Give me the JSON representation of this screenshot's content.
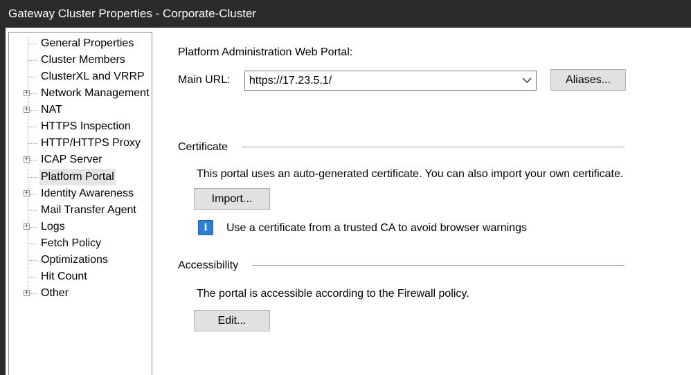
{
  "window": {
    "title": "Gateway Cluster Properties - Corporate-Cluster"
  },
  "tree": {
    "items": [
      {
        "label": "General Properties",
        "expandable": false,
        "selected": false
      },
      {
        "label": "Cluster Members",
        "expandable": false,
        "selected": false
      },
      {
        "label": "ClusterXL and VRRP",
        "expandable": false,
        "selected": false
      },
      {
        "label": "Network Management",
        "expandable": true,
        "selected": false
      },
      {
        "label": "NAT",
        "expandable": true,
        "selected": false
      },
      {
        "label": "HTTPS Inspection",
        "expandable": false,
        "selected": false
      },
      {
        "label": "HTTP/HTTPS Proxy",
        "expandable": false,
        "selected": false
      },
      {
        "label": "ICAP Server",
        "expandable": true,
        "selected": false
      },
      {
        "label": "Platform Portal",
        "expandable": false,
        "selected": true
      },
      {
        "label": "Identity Awareness",
        "expandable": true,
        "selected": false
      },
      {
        "label": "Mail Transfer Agent",
        "expandable": false,
        "selected": false
      },
      {
        "label": "Logs",
        "expandable": true,
        "selected": false
      },
      {
        "label": "Fetch Policy",
        "expandable": false,
        "selected": false
      },
      {
        "label": "Optimizations",
        "expandable": false,
        "selected": false
      },
      {
        "label": "Hit Count",
        "expandable": false,
        "selected": false
      },
      {
        "label": "Other",
        "expandable": true,
        "selected": false
      }
    ]
  },
  "portal": {
    "heading": "Platform Administration Web Portal:",
    "main_url_label": "Main URL:",
    "main_url_value": "https://17.23.5.1/",
    "aliases_button": "Aliases..."
  },
  "certificate": {
    "group_label": "Certificate",
    "description": "This portal uses an auto-generated certificate. You can also import your own certificate.",
    "import_button": "Import...",
    "info_icon": "info-icon",
    "info_text": "Use a certificate from a trusted CA to avoid browser warnings"
  },
  "accessibility": {
    "group_label": "Accessibility",
    "description": "The portal is accessible according to the Firewall policy.",
    "edit_button": "Edit..."
  },
  "colors": {
    "titlebar_bg": "#2b2b2b",
    "info_icon_bg": "#2d7fd6",
    "button_bg": "#e1e1e1",
    "selected_item_bg": "#e5e5e5"
  }
}
